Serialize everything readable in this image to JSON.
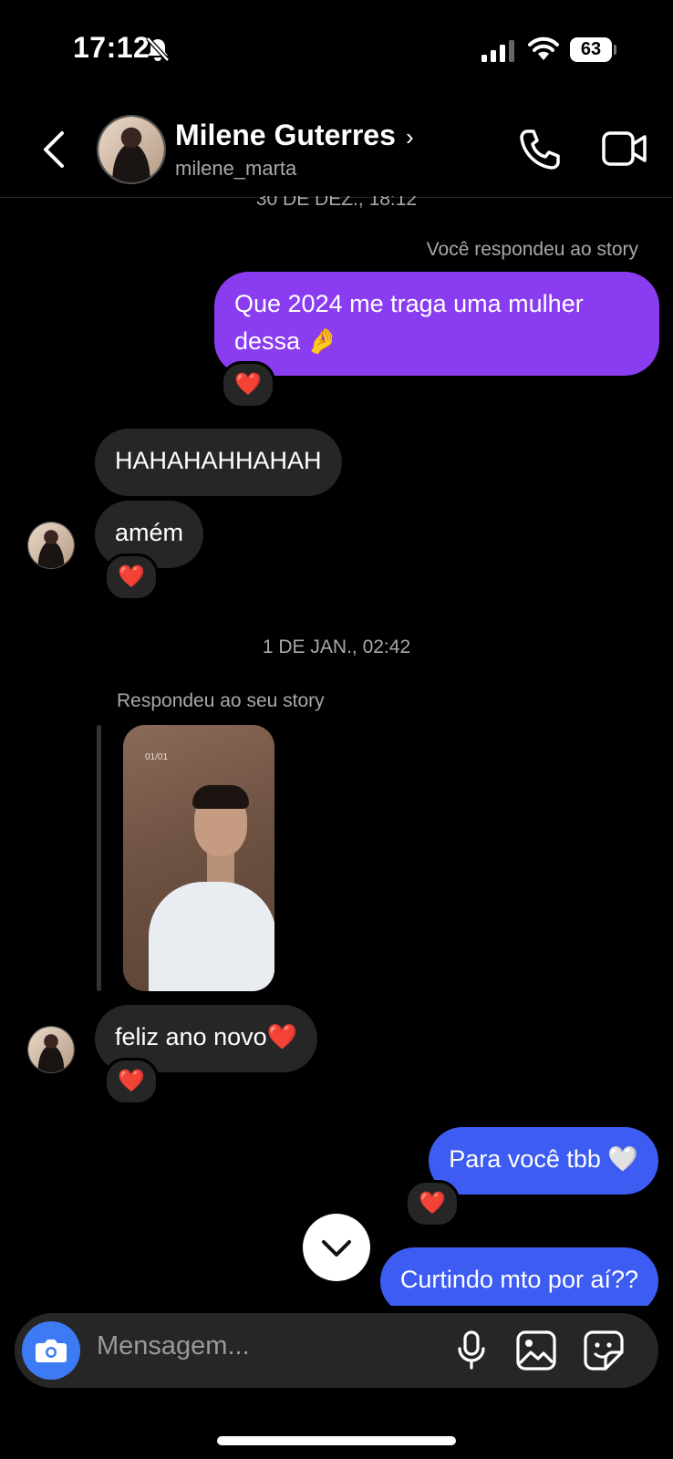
{
  "status_bar": {
    "time": "17:12",
    "battery": "63"
  },
  "header": {
    "name": "Milene Guterres",
    "username": "milene_marta",
    "chevron": "›"
  },
  "messages": {
    "timestamp_1": "30 DE DEZ., 18:12",
    "story_reply_note_1": "Você respondeu ao story",
    "out_1": "Que 2024 me traga uma mulher dessa 🤌",
    "in_1": "HAHAHAHHAHAH",
    "in_2": "amém",
    "timestamp_2": "1 DE JAN., 02:42",
    "story_reply_note_2": "Respondeu ao seu story",
    "story_date": "01/01",
    "in_3": "feliz ano novo❤️",
    "out_2": "Para você tbb 🤍",
    "out_3": "Curtindo mto por aí??",
    "reaction": "❤️"
  },
  "composer": {
    "placeholder": "Mensagem..."
  },
  "colors": {
    "outgoing_purple": "#8a3cf0",
    "outgoing_blue": "#3d5cf2",
    "incoming": "#262626",
    "camera_button": "#3d7bf5"
  }
}
